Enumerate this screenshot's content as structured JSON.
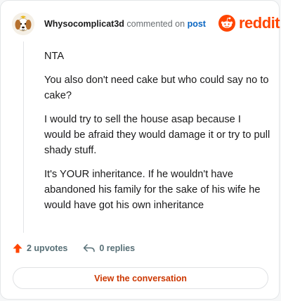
{
  "header": {
    "username": "Whysocomplicat3d",
    "commented_on": "commented on",
    "post_link": "post"
  },
  "brand": {
    "logo_text": "reddit",
    "icon": "reddit-snoo-icon",
    "color": "#ff4500"
  },
  "comment": {
    "paragraphs": [
      "NTA",
      "You also don't need cake but who could say no to cake?",
      "I would try to sell the house asap because I would be afraid they would damage it or try to pull shady stuff.",
      "It's YOUR inheritance. If he wouldn't have abandoned his family for the sake of his wife he would have got his own inheritance"
    ]
  },
  "actions": {
    "upvotes_label": "2 upvotes",
    "upvote_icon": "upvote-arrow-icon",
    "upvote_color": "#ff4500",
    "replies_label": "0 replies",
    "reply_icon": "reply-arrow-icon"
  },
  "cta": {
    "label": "View the conversation"
  }
}
